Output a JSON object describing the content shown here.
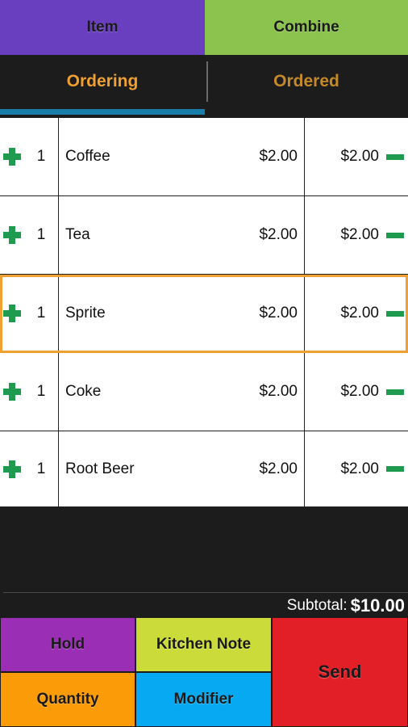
{
  "top_bar": {
    "item_label": "Item",
    "combine_label": "Combine"
  },
  "tabs": {
    "ordering": "Ordering",
    "ordered": "Ordered"
  },
  "order_items": [
    {
      "qty": "1",
      "name": "Coffee",
      "price": "$2.00",
      "total": "$2.00"
    },
    {
      "qty": "1",
      "name": "Tea",
      "price": "$2.00",
      "total": "$2.00"
    },
    {
      "qty": "1",
      "name": "Sprite",
      "price": "$2.00",
      "total": "$2.00"
    },
    {
      "qty": "1",
      "name": "Coke",
      "price": "$2.00",
      "total": "$2.00"
    },
    {
      "qty": "1",
      "name": "Root Beer",
      "price": "$2.00",
      "total": "$2.00"
    }
  ],
  "selected_index": 2,
  "subtotal": {
    "label": "Subtotal:",
    "value": "$10.00"
  },
  "actions": {
    "hold": "Hold",
    "kitchen_note": "Kitchen Note",
    "quantity": "Quantity",
    "modifier": "Modifier",
    "send": "Send"
  },
  "icons": {
    "add": "plus-icon",
    "remove": "minus-icon"
  },
  "colors": {
    "item": "#6a3fbf",
    "combine": "#8cc34f",
    "accent": "#f0a030",
    "tab_indicator": "#1a7fa8",
    "icon_green": "#1e9b4f",
    "hold": "#9a2fb5",
    "kitchen_note": "#cbdc3a",
    "quantity": "#fb9b08",
    "modifier": "#06a9f2",
    "send": "#e21f26"
  }
}
